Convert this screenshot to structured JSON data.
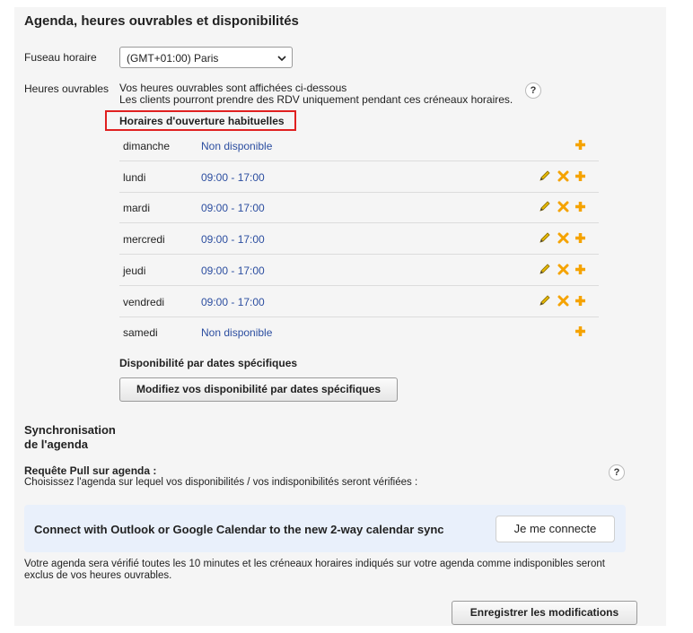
{
  "section_title": "Agenda, heures ouvrables et disponibilités",
  "timezone": {
    "label": "Fuseau horaire",
    "selected": "(GMT+01:00) Paris"
  },
  "business_hours": {
    "label": "Heures ouvrables",
    "desc_line1": "Vos heures ouvrables sont affichées ci-dessous",
    "desc_line2": "Les clients pourront prendre des RDV uniquement pendant ces créneaux horaires.",
    "help": "?",
    "usual_hours_title": "Horaires d'ouverture habituelles",
    "days": [
      {
        "day": "dimanche",
        "hours": "Non disponible",
        "editable": false
      },
      {
        "day": "lundi",
        "hours": "09:00 - 17:00",
        "editable": true
      },
      {
        "day": "mardi",
        "hours": "09:00 - 17:00",
        "editable": true
      },
      {
        "day": "mercredi",
        "hours": "09:00 - 17:00",
        "editable": true
      },
      {
        "day": "jeudi",
        "hours": "09:00 - 17:00",
        "editable": true
      },
      {
        "day": "vendredi",
        "hours": "09:00 - 17:00",
        "editable": true
      },
      {
        "day": "samedi",
        "hours": "Non disponible",
        "editable": false
      }
    ],
    "specific_dates_title": "Disponibilité par dates spécifiques",
    "specific_dates_button": "Modifiez vos disponibilité par dates spécifiques"
  },
  "sync": {
    "title_line1": "Synchronisation",
    "title_line2": "de l'agenda",
    "pull_title": "Requête Pull sur agenda :",
    "pull_desc": "Choisissez l'agenda sur lequel vos disponibilités / vos indisponibilités seront vérifiées :",
    "help": "?",
    "banner_text": "Connect with Outlook or Google Calendar to the new 2-way calendar sync",
    "connect_button": "Je me connecte",
    "note_line1": "Votre agenda sera vérifié toutes les 10 minutes et les créneaux horaires indiqués sur votre agenda comme indisponibles seront",
    "note_line2": "exclus de vos heures ouvrables."
  },
  "save_button": "Enregistrer les modifications",
  "colors": {
    "accent_orange": "#f5a300",
    "link_blue": "#2c4ea0",
    "highlight_red": "#e02020",
    "banner_bg": "#e9f0fb"
  }
}
